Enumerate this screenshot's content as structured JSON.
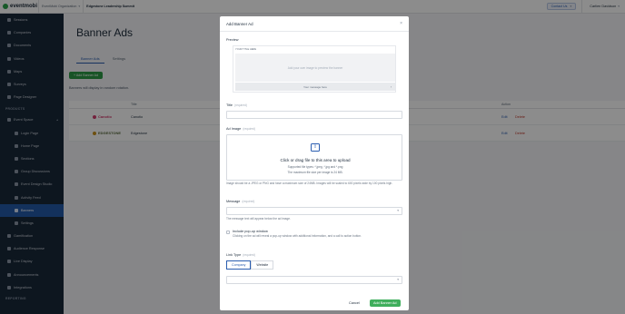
{
  "topbar": {
    "logo": "eventmobi",
    "breadcrumbs": [
      "EventMobi Organization",
      "Edgestone Leadership Summit"
    ],
    "contact_button": "Contact Us",
    "user": "Carlien Davidson"
  },
  "sidebar": {
    "items_top": [
      "Sessions",
      "Companies",
      "Documents",
      "Videos",
      "Maps",
      "Surveys",
      "Page Designer"
    ],
    "section_products": "PRODUCTS",
    "event_space": "Event Space",
    "event_space_children": [
      "Login Page",
      "Home Page",
      "Sections",
      "Group Discussions",
      "Event Design Studio",
      "Activity Feed",
      "Banners",
      "Settings"
    ],
    "active_item": "Banners",
    "items_bottom": [
      "Gamification",
      "Audience Response",
      "Live Display",
      "Announcements",
      "Integrations"
    ],
    "section_reporting": "REPORTING"
  },
  "main": {
    "title": "Banner Ads",
    "tabs": [
      "Banner Ads",
      "Settings"
    ],
    "add_button": "+ Add Banner Ad",
    "info": "Banners will display in random rotation.",
    "columns": {
      "title": "Title",
      "action": "Action"
    },
    "rows": [
      {
        "logo": "Canotio",
        "logo_color": "#d23c6e",
        "title": "Canotio",
        "edit": "Edit",
        "delete": "Delete"
      },
      {
        "logo": "EDGESTONE",
        "logo_color": "#c8921e",
        "title": "Edgestone",
        "edit": "Edit",
        "delete": "Delete"
      }
    ]
  },
  "modal": {
    "title": "Add Banner Ad",
    "close": "×",
    "preview_label": "Preview",
    "preview_title": "YOUR TITLE HERE",
    "preview_image_hint": "Add your own image to preview the banner",
    "preview_message": "Your message here",
    "preview_arrow": "›",
    "title_label": "Title",
    "required": "(required)",
    "ad_image_label": "Ad Image",
    "drop_main": "Click or drag file to this area to upload",
    "drop_types": "Supported file types: *.jpeg, *.jpg and *.png",
    "drop_size": "The maximum file size per image is 24 MB.",
    "image_help": "Image should be a JPEG or PNG and have a maximum size of 24MB. Images will be scaled to 600 pixels wide by 100 pixels high.",
    "message_label": "Message",
    "message_help": "The message text will appear below the ad image.",
    "popup_label": "Include pop-up window",
    "popup_help": "Clicking on the ad will reveal a pop-up window with additional information, and a call to action button.",
    "link_type_label": "Link Type",
    "link_types": [
      "Company",
      "Website"
    ],
    "link_type_active": "Company",
    "cancel": "Cancel",
    "submit": "Add Banner Ad"
  },
  "colors": {
    "sidebar_bg": "#18283a",
    "active": "#235aa8",
    "accent": "#2a5db0",
    "success": "#3fae5c"
  }
}
